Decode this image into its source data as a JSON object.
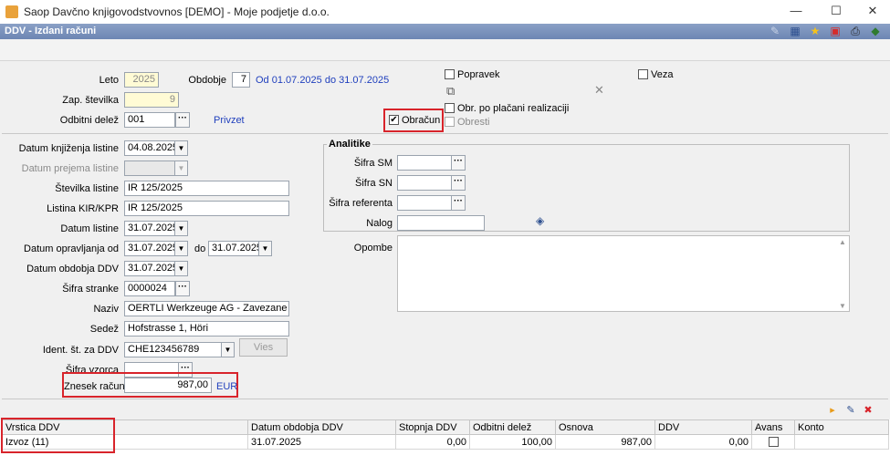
{
  "window": {
    "title": "Saop Davčno knjigovodstvovnos [DEMO] - Moje podjetje d.o.o.",
    "min": "—",
    "max": "☐",
    "close": "✕"
  },
  "header": {
    "title": "DDV - Izdani računi"
  },
  "form": {
    "leto_label": "Leto",
    "leto_value": "2025",
    "obdobje_label": "Obdobje",
    "obdobje_value": "7",
    "obdobje_range": "Od 01.07.2025 do 31.07.2025",
    "zap_label": "Zap. številka",
    "zap_value": "9",
    "odbitni_label": "Odbitni delež",
    "odbitni_value": "001",
    "privzet_link": "Privzet",
    "popravek_label": "Popravek",
    "veza_label": "Veza",
    "obr_placani_label": "Obr. po plačani realizaciji",
    "obracun_label": "Obračun",
    "obracun_checked": "✔",
    "obresti_label": "Obresti",
    "datum_knjizenja_label": "Datum knjiženja listine",
    "datum_knjizenja_value": "04.08.2025",
    "datum_prejema_label": "Datum prejema listine",
    "datum_prejema_value": "",
    "stevilka_label": "Številka listine",
    "stevilka_value": "IR 125/2025",
    "listina_kir_label": "Listina KIR/KPR",
    "listina_kir_value": "IR 125/2025",
    "datum_listine_label": "Datum listine",
    "datum_listine_value": "31.07.2025",
    "datum_opr_label": "Datum opravljanja od",
    "datum_opr_od": "31.07.2025",
    "do_label": "do",
    "datum_opr_do": "31.07.2025",
    "datum_obdobja_label": "Datum obdobja DDV",
    "datum_obdobja_value": "31.07.2025",
    "sifra_stranke_label": "Šifra stranke",
    "sifra_stranke_value": "0000024",
    "naziv_label": "Naziv",
    "naziv_value": "OERTLI Werkzeuge AG - Zavezane",
    "sedez_label": "Sedež",
    "sedez_value": "Hofstrasse 1, Höri",
    "ident_label": "Ident. št. za DDV",
    "ident_value": "CHE123456789",
    "vies_button": "Vies",
    "sifra_vzorca_label": "Šifra vzorca",
    "sifra_vzorca_value": "",
    "znesek_label": "Znesek računa",
    "znesek_value": "987,00",
    "currency_link": "EUR"
  },
  "analitike": {
    "title": "Analitike",
    "sm_label": "Šifra SM",
    "sn_label": "Šifra SN",
    "referent_label": "Šifra referenta",
    "nalog_label": "Nalog"
  },
  "opombe_label": "Opombe",
  "grid": {
    "columns": [
      "Vrstica DDV",
      "Datum obdobja DDV",
      "Stopnja DDV",
      "Odbitni delež",
      "Osnova",
      "DDV",
      "Avans",
      "Konto"
    ],
    "rows": [
      {
        "vrstica": "Izvoz (11)",
        "datum": "31.07.2025",
        "stopnja": "0,00",
        "odbitni": "100,00",
        "osnova": "987,00",
        "ddv": "0,00",
        "avans": "",
        "konto": ""
      }
    ]
  }
}
